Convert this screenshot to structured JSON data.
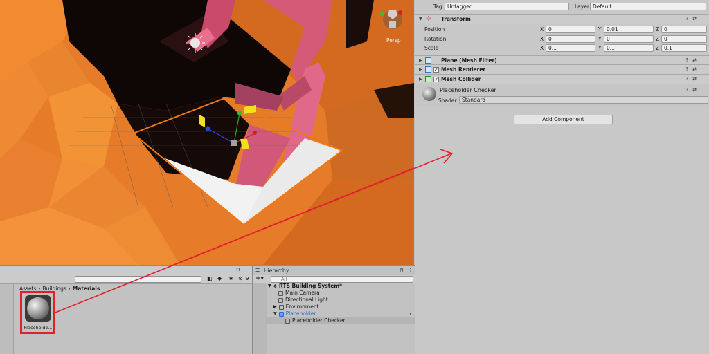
{
  "inspector": {
    "tag_label": "Tag",
    "tag_value": "Untagged",
    "layer_label": "Layer",
    "layer_value": "Default",
    "transform": {
      "title": "Transform",
      "position_label": "Position",
      "rotation_label": "Rotation",
      "scale_label": "Scale",
      "axis_x": "X",
      "axis_y": "Y",
      "axis_z": "Z",
      "position": [
        "0",
        "0.01",
        "0"
      ],
      "rotation": [
        "0",
        "0",
        "0"
      ],
      "scale": [
        "0.1",
        "0.1",
        "0.1"
      ]
    },
    "components": [
      "Plane (Mesh Filter)",
      "Mesh Renderer",
      "Mesh Collider"
    ],
    "material": {
      "name": "Placeholder Checker",
      "shader_label": "Shader",
      "shader_value": "Standard"
    },
    "add_component_label": "Add Component"
  },
  "scene": {
    "persp_label": "Persp"
  },
  "project": {
    "breadcrumb": [
      "Assets",
      "Buildings",
      "Materials"
    ],
    "asset_label": "Placeholde...",
    "visible_count": "9"
  },
  "hierarchy": {
    "tab_label": "Hierarchy",
    "search_placeholder": "All",
    "items": [
      "RTS Building System*",
      "Main Camera",
      "Directional Light",
      "Environment",
      "Placeholder",
      "Placeholder Checker"
    ]
  },
  "colors": {
    "annotation_red": "#e0202a",
    "selection_orange": "#f07a10",
    "hierarchy_link_blue": "#2a6ad0"
  }
}
